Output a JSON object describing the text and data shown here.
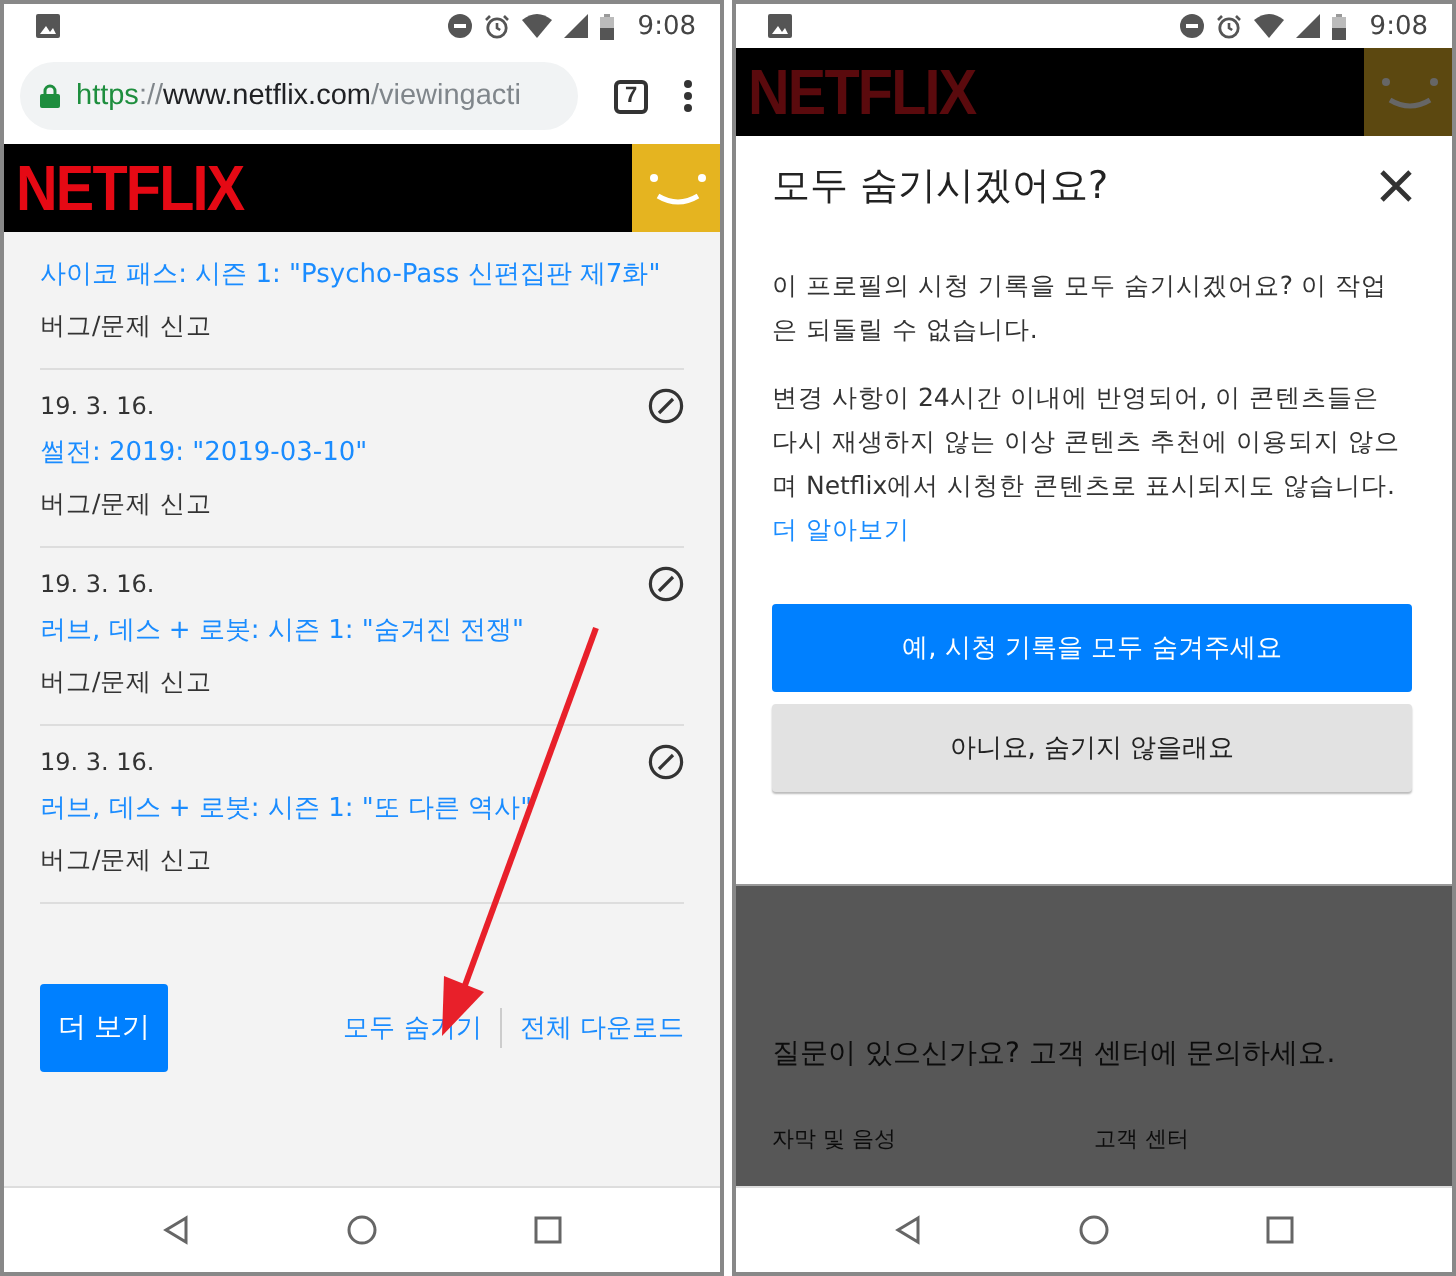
{
  "left_phone": {
    "status_bar": {
      "time": "9:08"
    },
    "browser": {
      "url": [
        {
          "text": "https",
          "kind": "secure"
        },
        {
          "text": "://",
          "kind": "muted"
        },
        {
          "text": "www.netflix.com",
          "kind": "host"
        },
        {
          "text": "/viewingacti",
          "kind": "muted"
        }
      ],
      "tab_count": "7"
    },
    "logo": "NETFLIX",
    "history": [
      {
        "title": "사이코 패스: 시즌 1: \"Psycho-Pass 신편집판 제7화\"",
        "report": "버그/문제 신고"
      },
      {
        "date": "19. 3. 16.",
        "title": "썰전: 2019: \"2019-03-10\"",
        "report": "버그/문제 신고"
      },
      {
        "date": "19. 3. 16.",
        "title": "러브, 데스 + 로봇: 시즌 1: \"숨겨진 전쟁\"",
        "report": "버그/문제 신고"
      },
      {
        "date": "19. 3. 16.",
        "title": "러브, 데스 + 로봇: 시즌 1: \"또 다른 역사\"",
        "report": "버그/문제 신고"
      }
    ],
    "more_button": "더 보기",
    "links": [
      "모두 숨기기",
      "전체 다운로드"
    ]
  },
  "right_phone": {
    "status_bar": {
      "time": "9:08"
    },
    "logo": "NETFLIX",
    "dialog": {
      "title": "모두 숨기시겠어요?",
      "paragraphs": [
        "이 프로필의 시청 기록을 모두 숨기시겠어요? 이 작업은 되돌릴 수 없습니다.",
        "변경 사항이 24시간 이내에 반영되어, 이 콘텐츠들은 다시 재생하지 않는 이상 콘텐츠 추천에 이용되지 않으며 Netflix에서 시청한 콘텐츠로 표시되지도 않습니다."
      ],
      "learn_more": "더 알아보기",
      "buttons": [
        {
          "label": "예, 시청 기록을 모두 숨겨주세요",
          "kind": "primary"
        },
        {
          "label": "아니요, 숨기지 않을래요",
          "kind": "secondary"
        }
      ]
    },
    "footer": {
      "question": "질문이 있으신가요? 고객 센터에 문의하세요.",
      "links": [
        "자막 및 음성",
        "고객 센터"
      ]
    }
  }
}
